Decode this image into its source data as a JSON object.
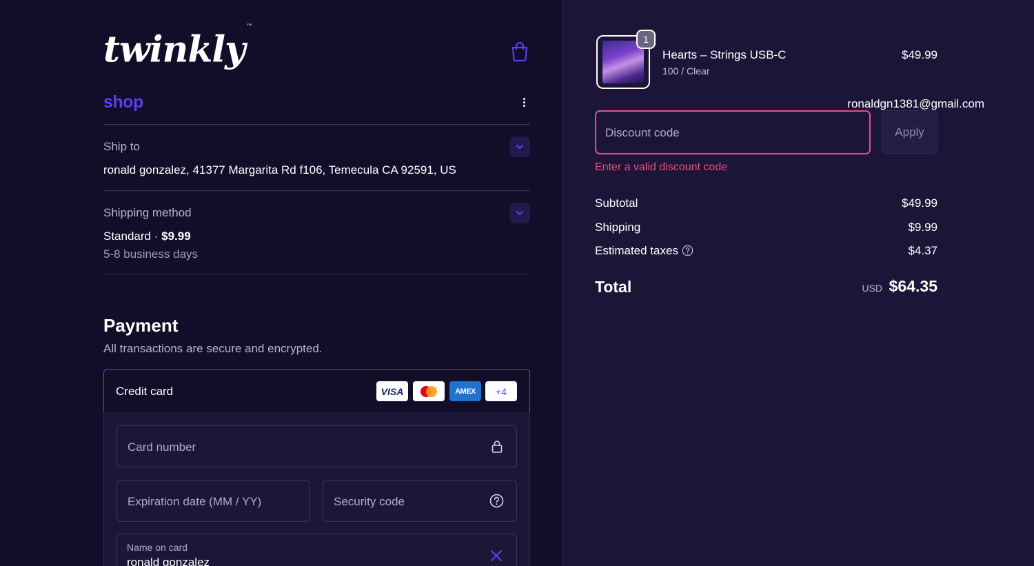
{
  "brand": {
    "logo_text": "twinkly",
    "logo_mark": "™",
    "shop_label": "shop"
  },
  "account": {
    "email": "ronaldgn1381@gmail.com"
  },
  "ship_to": {
    "label": "Ship to",
    "address": "ronald gonzalez, 41377 Margarita Rd f106, Temecula CA 92591, US"
  },
  "shipping_method": {
    "label": "Shipping method",
    "name": "Standard",
    "separator": "·",
    "price": "$9.99",
    "eta": "5-8 business days"
  },
  "payment": {
    "title": "Payment",
    "subtitle": "All transactions are secure and encrypted.",
    "method_label": "Credit card",
    "card_logos": [
      "VISA",
      "mastercard",
      "AMEX",
      "+4"
    ],
    "fields": {
      "card_number_placeholder": "Card number",
      "expiry_placeholder": "Expiration date (MM / YY)",
      "security_placeholder": "Security code",
      "name_label": "Name on card",
      "name_value": "ronald gonzalez"
    }
  },
  "order": {
    "item": {
      "name": "Hearts – Strings USB-C",
      "variant": "100 / Clear",
      "price": "$49.99",
      "quantity": "1"
    },
    "discount": {
      "placeholder": "Discount code",
      "apply_label": "Apply",
      "error": "Enter a valid discount code"
    },
    "summary": {
      "subtotal_label": "Subtotal",
      "subtotal_value": "$49.99",
      "shipping_label": "Shipping",
      "shipping_value": "$9.99",
      "taxes_label": "Estimated taxes",
      "taxes_value": "$4.37",
      "total_label": "Total",
      "currency": "USD",
      "total_value": "$64.35"
    }
  },
  "colors": {
    "background_left": "#120d28",
    "background_right": "#1c1538",
    "accent": "#5b3ff0",
    "error": "#e0557f"
  }
}
